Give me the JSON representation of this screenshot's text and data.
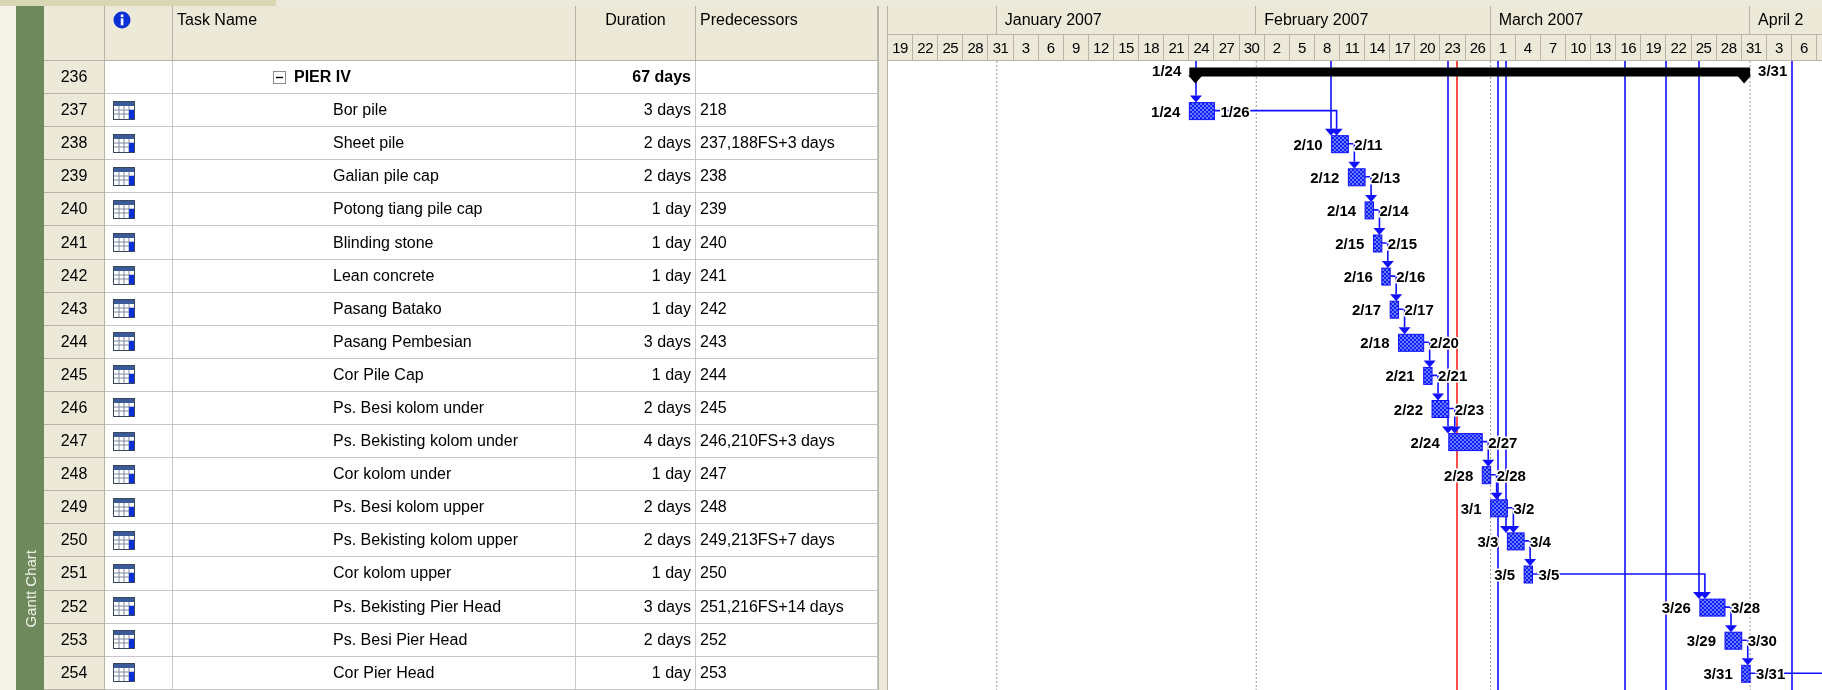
{
  "view_bar": {
    "label": "Gantt Chart"
  },
  "table": {
    "columns": [
      {
        "label": "Task Name"
      },
      {
        "label": "Duration"
      },
      {
        "label": "Predecessors"
      }
    ],
    "rows": [
      {
        "id": "236",
        "kind": "summary",
        "expanded": true,
        "name": "PIER IV",
        "duration": "67 days",
        "start": "1/24",
        "finish": "3/31",
        "children": [
          {
            "id": "237",
            "kind": "task",
            "name": "Bor pile",
            "duration": "3 days",
            "predecessors": "218",
            "start": "1/24",
            "finish": "1/26"
          },
          {
            "id": "238",
            "kind": "task",
            "name": "Sheet pile",
            "duration": "2 days",
            "predecessors": "237,188FS+3 days",
            "start": "2/10",
            "finish": "2/11"
          },
          {
            "id": "239",
            "kind": "task",
            "name": "Galian pile cap",
            "duration": "2 days",
            "predecessors": "238",
            "start": "2/12",
            "finish": "2/13"
          },
          {
            "id": "240",
            "kind": "task",
            "name": "Potong tiang pile cap",
            "duration": "1 day",
            "predecessors": "239",
            "start": "2/14",
            "finish": "2/14"
          },
          {
            "id": "241",
            "kind": "task",
            "name": "Blinding stone",
            "duration": "1 day",
            "predecessors": "240",
            "start": "2/15",
            "finish": "2/15"
          },
          {
            "id": "242",
            "kind": "task",
            "name": "Lean concrete",
            "duration": "1 day",
            "predecessors": "241",
            "start": "2/16",
            "finish": "2/16"
          },
          {
            "id": "243",
            "kind": "task",
            "name": "Pasang Batako",
            "duration": "1 day",
            "predecessors": "242",
            "start": "2/17",
            "finish": "2/17"
          },
          {
            "id": "244",
            "kind": "task",
            "name": "Pasang Pembesian",
            "duration": "3 days",
            "predecessors": "243",
            "start": "2/18",
            "finish": "2/20"
          },
          {
            "id": "245",
            "kind": "task",
            "name": "Cor Pile Cap",
            "duration": "1 day",
            "predecessors": "244",
            "start": "2/21",
            "finish": "2/21"
          },
          {
            "id": "246",
            "kind": "task",
            "name": "Ps. Besi kolom under",
            "duration": "2 days",
            "predecessors": "245",
            "start": "2/22",
            "finish": "2/23"
          },
          {
            "id": "247",
            "kind": "task",
            "name": "Ps. Bekisting kolom under",
            "duration": "4 days",
            "predecessors": "246,210FS+3 days",
            "start": "2/24",
            "finish": "2/27"
          },
          {
            "id": "248",
            "kind": "task",
            "name": "Cor kolom under",
            "duration": "1 day",
            "predecessors": "247",
            "start": "2/28",
            "finish": "2/28"
          },
          {
            "id": "249",
            "kind": "task",
            "name": "Ps. Besi kolom upper",
            "duration": "2 days",
            "predecessors": "248",
            "start": "3/1",
            "finish": "3/2"
          },
          {
            "id": "250",
            "kind": "task",
            "name": "Ps. Bekisting kolom upper",
            "duration": "2 days",
            "predecessors": "249,213FS+7 days",
            "start": "3/3",
            "finish": "3/4"
          },
          {
            "id": "251",
            "kind": "task",
            "name": "Cor kolom upper",
            "duration": "1 day",
            "predecessors": "250",
            "start": "3/5",
            "finish": "3/5"
          },
          {
            "id": "252",
            "kind": "task",
            "name": "Ps. Bekisting Pier Head",
            "duration": "3 days",
            "predecessors": "251,216FS+14 days",
            "start": "3/26",
            "finish": "3/28"
          },
          {
            "id": "253",
            "kind": "task",
            "name": "Ps. Besi Pier Head",
            "duration": "2 days",
            "predecessors": "252",
            "start": "3/29",
            "finish": "3/30"
          },
          {
            "id": "254",
            "kind": "task",
            "name": "Cor Pier Head",
            "duration": "1 day",
            "predecessors": "253",
            "start": "3/31",
            "finish": "3/31"
          }
        ]
      }
    ]
  },
  "timescale": {
    "months": [
      {
        "label": "January 2007"
      },
      {
        "label": "February 2007"
      },
      {
        "label": "March 2007"
      },
      {
        "label": "April 2"
      }
    ],
    "days": [
      "19",
      "22",
      "25",
      "28",
      "31",
      "3",
      "6",
      "9",
      "12",
      "15",
      "18",
      "21",
      "24",
      "27",
      "30",
      "2",
      "5",
      "8",
      "11",
      "14",
      "17",
      "20",
      "23",
      "26",
      "1",
      "4",
      "7",
      "10",
      "13",
      "16",
      "19",
      "22",
      "25",
      "28",
      "31",
      "3",
      "6"
    ]
  }
}
